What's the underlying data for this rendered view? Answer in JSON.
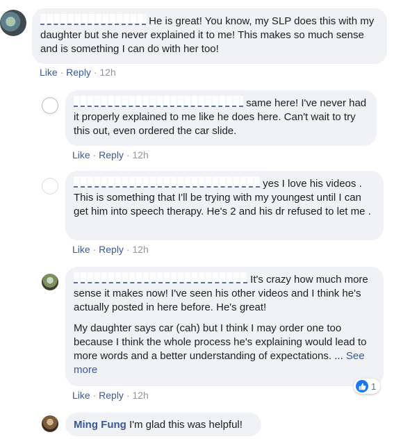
{
  "comments": [
    {
      "author": "",
      "text": "He is great! You know, my SLP does this with my daughter but she never explained it to me! This makes so much sense and is something I can do with her too!",
      "actions": {
        "like": "Like",
        "reply": "Reply",
        "time": "12h"
      }
    },
    {
      "author": "",
      "text": "same here! I've never had it properly explained to me like he does here. Can't wait to try this out, even ordered the car slide.",
      "actions": {
        "like": "Like",
        "reply": "Reply",
        "time": "12h"
      }
    },
    {
      "author": "",
      "text": "yes I love his videos . This is something that I'll be trying with my youngest until I can get him into speech therapy. He's 2 and his dr refused to let me .",
      "actions": {
        "like": "Like",
        "reply": "Reply",
        "time": "12h"
      }
    },
    {
      "author": "",
      "text": "It's crazy how much more sense it makes now! I've seen his other videos and I think he's actually posted in here before. He's great!",
      "text2": "My daughter says car (cah) but I think I may order one too because I think the whole process he's explaining would lead to more words and a better understanding of expectations.",
      "ellipsis": "...",
      "see_more": "See more",
      "reaction_count": "1",
      "actions": {
        "like": "Like",
        "reply": "Reply",
        "time": "12h"
      }
    },
    {
      "author": "Ming Fung",
      "text": "I'm glad this was helpful!"
    }
  ],
  "separator": "·",
  "colors": {
    "link": "#385898",
    "bubble": "#f0f2f5",
    "like_blue": "#1877f2"
  }
}
